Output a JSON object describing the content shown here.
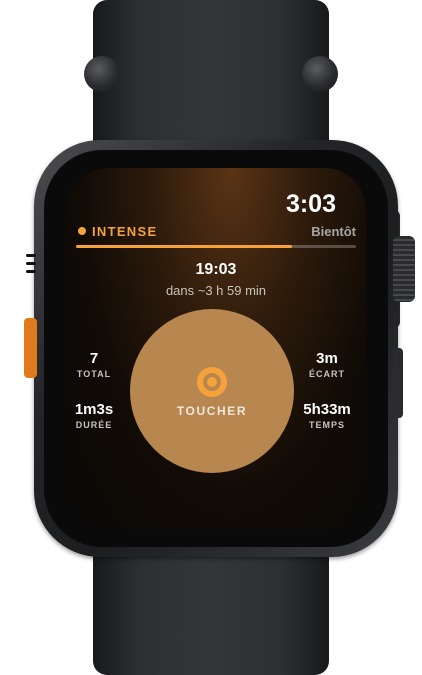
{
  "screen": {
    "clock": "3:03",
    "mode": {
      "label": "INTENSE",
      "color": "#f5a23a"
    },
    "next_label": "Bientôt",
    "progress": 0.77,
    "target": {
      "time": "19:03",
      "countdown": "dans ~3 h 59 min"
    },
    "touch_button": {
      "label": "TOUCHER",
      "icon": "target-ring-icon",
      "color": "#b7874f"
    },
    "stats": {
      "total": {
        "value": "7",
        "label": "TOTAL"
      },
      "ecart": {
        "value": "3m",
        "label": "ÉCART"
      },
      "duree": {
        "value": "1m3s",
        "label": "DURÉE"
      },
      "temps": {
        "value": "5h33m",
        "label": "TEMPS"
      }
    }
  },
  "device": {
    "action_button_color": "#e07a1a"
  }
}
